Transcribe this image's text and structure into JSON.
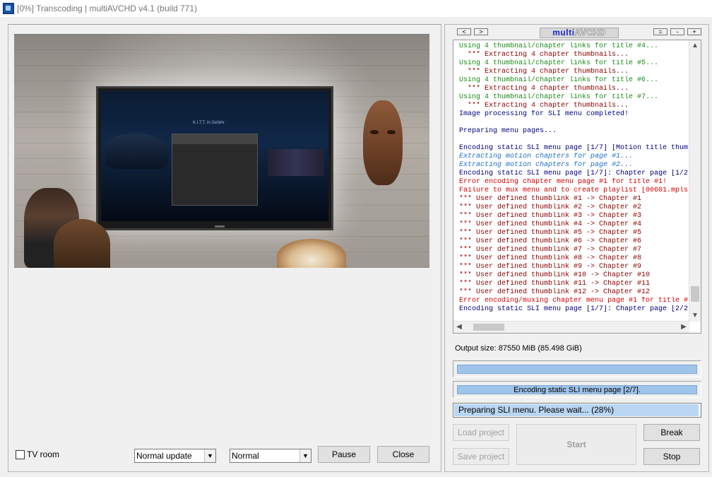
{
  "window": {
    "title": "[0%] Transcoding | multiAVCHD v4.1 (build 771)"
  },
  "header": {
    "prev_label": "<",
    "next_label": ">",
    "brand_part1": "multi",
    "brand_part2": "AVCHD",
    "btn_equal": "=",
    "btn_minus": "-",
    "btn_plus": "+"
  },
  "log": {
    "lines": [
      {
        "text": "Using 4 thumbnail/chapter links for title #4...",
        "color": "#1a8a1a",
        "italic": false
      },
      {
        "text": "  *** Extracting 4 chapter thumbnails...",
        "color": "#8b0000",
        "italic": false
      },
      {
        "text": "Using 4 thumbnail/chapter links for title #5...",
        "color": "#1a8a1a",
        "italic": false
      },
      {
        "text": "  *** Extracting 4 chapter thumbnails...",
        "color": "#8b0000",
        "italic": false
      },
      {
        "text": "Using 4 thumbnail/chapter links for title #6...",
        "color": "#1a8a1a",
        "italic": false
      },
      {
        "text": "  *** Extracting 4 chapter thumbnails...",
        "color": "#8b0000",
        "italic": false
      },
      {
        "text": "Using 4 thumbnail/chapter links for title #7...",
        "color": "#1a8a1a",
        "italic": false
      },
      {
        "text": "  *** Extracting 4 chapter thumbnails...",
        "color": "#8b0000",
        "italic": false
      },
      {
        "text": "Image processing for SLI menu completed!",
        "color": "#000080",
        "italic": false
      },
      {
        "text": "",
        "color": "#000080",
        "italic": false
      },
      {
        "text": "Preparing menu pages...",
        "color": "#000080",
        "italic": false
      },
      {
        "text": "",
        "color": "#000080",
        "italic": false
      },
      {
        "text": "Encoding static SLI menu page [1/7] [Motion title thum",
        "color": "#000080",
        "italic": false
      },
      {
        "text": "Extracting motion chapters for page #1...",
        "color": "#1e6fc4",
        "italic": true
      },
      {
        "text": "Extracting motion chapters for page #2...",
        "color": "#1e6fc4",
        "italic": true
      },
      {
        "text": "Encoding static SLI menu page [1/7]: Chapter page [1/2",
        "color": "#000080",
        "italic": false
      },
      {
        "text": "Error encoding chapter menu page #1 for title #1!",
        "color": "#d40000",
        "italic": false
      },
      {
        "text": "Failure to mux menu and to create playlist [00601.mpls",
        "color": "#d40000",
        "italic": false
      },
      {
        "text": "*** User defined thumblink #1 -> Chapter #1",
        "color": "#8b0000",
        "italic": false
      },
      {
        "text": "*** User defined thumblink #2 -> Chapter #2",
        "color": "#8b0000",
        "italic": false
      },
      {
        "text": "*** User defined thumblink #3 -> Chapter #3",
        "color": "#8b0000",
        "italic": false
      },
      {
        "text": "*** User defined thumblink #4 -> Chapter #4",
        "color": "#8b0000",
        "italic": false
      },
      {
        "text": "*** User defined thumblink #5 -> Chapter #5",
        "color": "#8b0000",
        "italic": false
      },
      {
        "text": "*** User defined thumblink #6 -> Chapter #6",
        "color": "#8b0000",
        "italic": false
      },
      {
        "text": "*** User defined thumblink #7 -> Chapter #7",
        "color": "#8b0000",
        "italic": false
      },
      {
        "text": "*** User defined thumblink #8 -> Chapter #8",
        "color": "#8b0000",
        "italic": false
      },
      {
        "text": "*** User defined thumblink #9 -> Chapter #9",
        "color": "#8b0000",
        "italic": false
      },
      {
        "text": "*** User defined thumblink #10 -> Chapter #10",
        "color": "#8b0000",
        "italic": false
      },
      {
        "text": "*** User defined thumblink #11 -> Chapter #11",
        "color": "#8b0000",
        "italic": false
      },
      {
        "text": "*** User defined thumblink #12 -> Chapter #12",
        "color": "#8b0000",
        "italic": false
      },
      {
        "text": "Error encoding/muxing chapter menu page #1 for title #",
        "color": "#d40000",
        "italic": false
      },
      {
        "text": "Encoding static SLI menu page [1/7]: Chapter page [2/2",
        "color": "#000080",
        "italic": false
      }
    ]
  },
  "output": {
    "size_text": "Output size: 87550 MiB (85.498 GiB)"
  },
  "progress": {
    "overall_fraction": 1.0,
    "step_fraction": 1.0,
    "step_label": "Encoding static SLI menu page [2/7].",
    "status_text": "Preparing SLI menu. Please wait... (28%)",
    "status_fraction": 1.0
  },
  "buttons": {
    "load_project": "Load project",
    "save_project": "Save project",
    "start": "Start",
    "break": "Break",
    "stop": "Stop",
    "pause": "Pause",
    "close": "Close"
  },
  "bottom": {
    "tv_room_label": "TV room",
    "tv_room_checked": false,
    "update_mode": "Normal update",
    "priority": "Normal"
  },
  "icons": {
    "app": "multiavchd-app-icon",
    "scroll_up": "▲",
    "scroll_down": "▼",
    "scroll_left": "◀",
    "scroll_right": "▶",
    "combo_arrow": "▼"
  },
  "preview": {
    "tv_screen_title": "K.I.T.T. in Gefahr"
  }
}
